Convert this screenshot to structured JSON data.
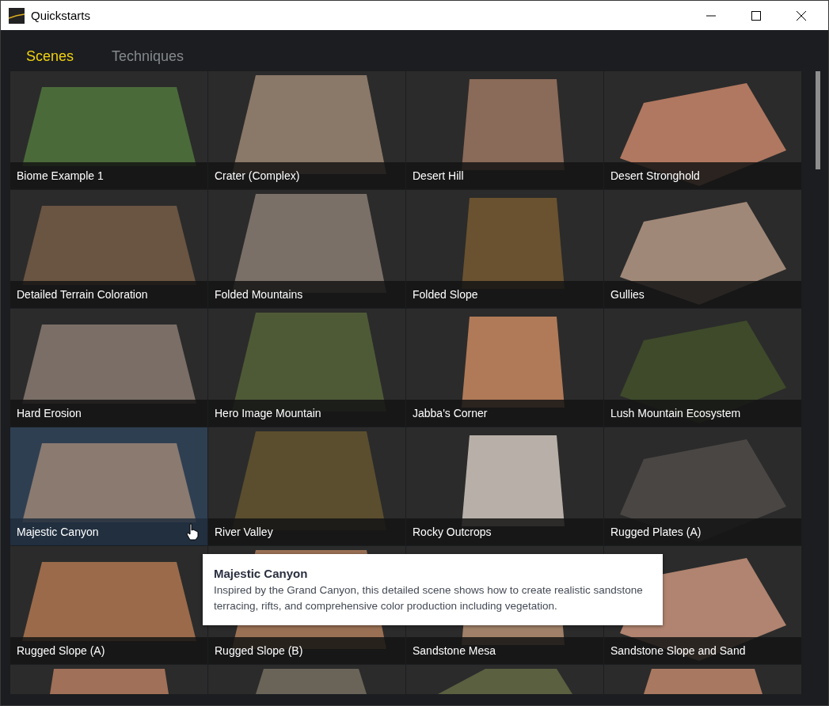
{
  "window": {
    "title": "Quickstarts"
  },
  "tabs": [
    {
      "label": "Scenes",
      "selected": true
    },
    {
      "label": "Techniques",
      "selected": false
    }
  ],
  "scenes": [
    {
      "label": "Biome Example 1",
      "hovered": false,
      "color": "#4a6a3a"
    },
    {
      "label": "Crater (Complex)",
      "hovered": false,
      "color": "#8a7868"
    },
    {
      "label": "Desert Hill",
      "hovered": false,
      "color": "#8a6a58"
    },
    {
      "label": "Desert Stronghold",
      "hovered": false,
      "color": "#b07860"
    },
    {
      "label": "Detailed Terrain Coloration",
      "hovered": false,
      "color": "#6a5442"
    },
    {
      "label": "Folded Mountains",
      "hovered": false,
      "color": "#7a7068"
    },
    {
      "label": "Folded Slope",
      "hovered": false,
      "color": "#6a5230"
    },
    {
      "label": "Gullies",
      "hovered": false,
      "color": "#a08878"
    },
    {
      "label": "Hard Erosion",
      "hovered": false,
      "color": "#7a6e66"
    },
    {
      "label": "Hero Image Mountain",
      "hovered": false,
      "color": "#4e5a36"
    },
    {
      "label": "Jabba's Corner",
      "hovered": false,
      "color": "#b07a58"
    },
    {
      "label": "Lush Mountain Ecosystem",
      "hovered": false,
      "color": "#3e4a2a"
    },
    {
      "label": "Majestic Canyon",
      "hovered": true,
      "color": "#8a7a70"
    },
    {
      "label": "River Valley",
      "hovered": false,
      "color": "#5a4e2e"
    },
    {
      "label": "Rocky Outcrops",
      "hovered": false,
      "color": "#b8b0a8"
    },
    {
      "label": "Rugged Plates (A)",
      "hovered": false,
      "color": "#4a4644"
    },
    {
      "label": "Rugged Slope (A)",
      "hovered": false,
      "color": "#9a6a4a"
    },
    {
      "label": "Rugged Slope (B)",
      "hovered": false,
      "color": "#9a7054"
    },
    {
      "label": "Sandstone Mesa",
      "hovered": false,
      "color": "#a08068"
    },
    {
      "label": "Sandstone Slope and Sand",
      "hovered": false,
      "color": "#b08470"
    }
  ],
  "more_scenes": [
    {
      "color": "#a07058"
    },
    {
      "color": "#6a6458"
    },
    {
      "color": "#5a6040"
    },
    {
      "color": "#a87860"
    }
  ],
  "tooltip": {
    "title": "Majestic Canyon",
    "text": "Inspired by the Grand Canyon, this detailed scene shows how to create realistic sandstone terracing, rifts, and comprehensive color production including vegetation."
  }
}
